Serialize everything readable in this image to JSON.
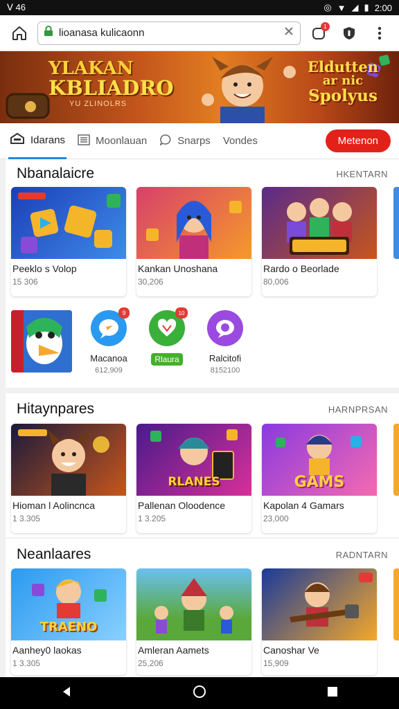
{
  "status_bar": {
    "left_text": "ᐯ 46",
    "time": "2:00"
  },
  "browser": {
    "url": "lioanasa kulicaonn",
    "notification_count": "1"
  },
  "banner": {
    "title_line1": "YLAKAN",
    "title_line2": "KBLIADRO",
    "subtitle": "YU ZLINOLRS",
    "right_line1": "Eldutten",
    "right_line2": "ar nic",
    "right_line3": "Spolyus"
  },
  "tabs": [
    {
      "label": "Idarans"
    },
    {
      "label": "Moonlauan"
    },
    {
      "label": "Snarps"
    },
    {
      "label": "Vondes"
    },
    {
      "label": "Metenon"
    }
  ],
  "sections": [
    {
      "title": "Nbanalaicre",
      "link": "HKENTARN",
      "cards": [
        {
          "title": "Peeklo s Volop",
          "sub": "15 306"
        },
        {
          "title": "Kankan Unoshana",
          "sub": "30,206"
        },
        {
          "title": "Rardo o Beorlade",
          "sub": "80,006"
        }
      ],
      "apps": [
        {
          "name": "Macanoa",
          "count": "612,909",
          "badge": "9"
        },
        {
          "name": "Rlaura",
          "count": "",
          "badge": "10"
        },
        {
          "name": "Ralcitofi",
          "count": "8152100",
          "badge": ""
        }
      ]
    },
    {
      "title": "Hitaynpares",
      "link": "HARNPRSAN",
      "cards": [
        {
          "title": "Hioman l Aolincnca",
          "sub": "1 3.305",
          "thumb_text": ""
        },
        {
          "title": "Pallenan Oloodence",
          "sub": "1 3.205",
          "thumb_text": "RLANES"
        },
        {
          "title": "Kapolan 4 Gamars",
          "sub": "23,000",
          "thumb_text": "GAMS"
        }
      ]
    },
    {
      "title": "Neanlaares",
      "link": "RADNTARN",
      "cards": [
        {
          "title": "Aanhey0 laokas",
          "sub": "1 3.305",
          "thumb_text": "TRAENO"
        },
        {
          "title": "Amleran Aamets",
          "sub": "25,206"
        },
        {
          "title": "Canoshar Ve",
          "sub": "15,909"
        }
      ]
    }
  ],
  "icons": {
    "home": "home-icon",
    "lock": "lock-icon",
    "close": "close-icon",
    "tabs": "tabs-icon",
    "shield": "shield-icon",
    "menu": "more-vert-icon"
  },
  "colors": {
    "accent": "#1e88e5",
    "cta": "#e32119",
    "banner": "#c4561c"
  }
}
